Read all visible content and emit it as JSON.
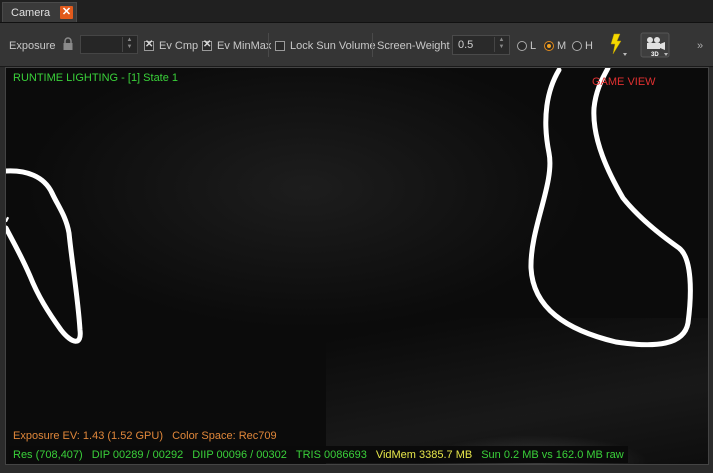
{
  "tab": {
    "title": "Camera",
    "close_glyph": "✕"
  },
  "toolbar": {
    "exposure_label": "Exposure",
    "exposure_value": "",
    "ev_cmp_label": "Ev Cmp",
    "ev_cmp_checked": true,
    "ev_minmax_label": "Ev MinMax",
    "ev_minmax_checked": true,
    "lock_sun_label": "Lock Sun Volume",
    "lock_sun_checked": false,
    "screen_weight_label": "Screen-Weight",
    "screen_weight_value": "0.5",
    "quality_options": [
      {
        "label": "L",
        "selected": false
      },
      {
        "label": "M",
        "selected": true
      },
      {
        "label": "H",
        "selected": false
      }
    ],
    "lightning_icon_color": "#f5d800",
    "camera_badge": "3D"
  },
  "viewport": {
    "runtime_label": "RUNTIME LIGHTING - [1] State 1",
    "game_view_label": "GAME VIEW",
    "exposure_line": "Exposure EV: 1.43 (1.52 GPU)",
    "color_space": "Color Space: Rec709",
    "status": {
      "res": "Res (708,407)",
      "dip": "DIP 00289 / 00292",
      "diip": "DIIP 00096 / 00302",
      "tris": "TRIS 0086693",
      "vidmem": "VidMem 3385.7 MB",
      "sun": "Sun 0.2 MB vs 162.0 MB raw"
    }
  },
  "colors": {
    "accent_orange": "#e25a1c",
    "overlay_green": "#3ad13a",
    "overlay_red": "#e03030",
    "overlay_orange": "#e0873a",
    "overlay_yellow": "#e8e84a"
  }
}
